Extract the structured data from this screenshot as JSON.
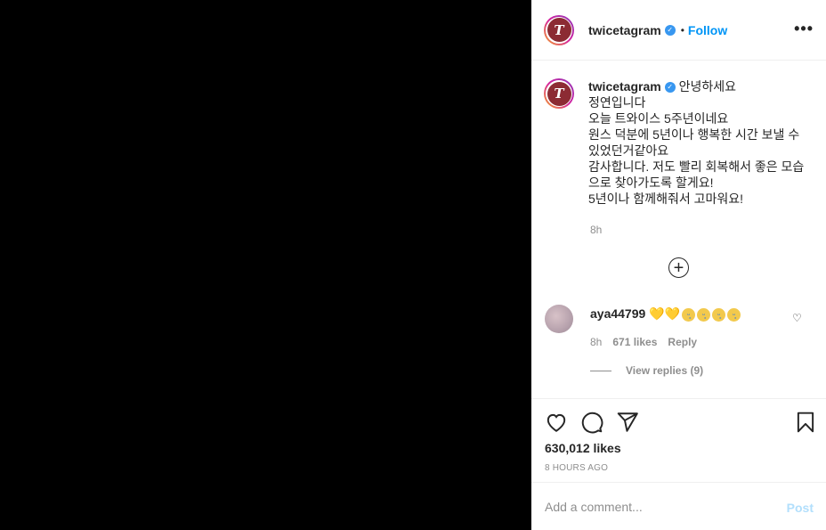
{
  "header": {
    "username": "twicetagram",
    "separator": "•",
    "follow_label": "Follow",
    "more_label": "•••",
    "avatar_initial": "T"
  },
  "caption": {
    "username": "twicetagram",
    "text": "안녕하세요\n정연입니다\n오늘 트와이스 5주년이네요\n원스 덕분에 5년이나 행복한 시간 보낼 수 있었던거같아요\n감사합니다. 저도 빨리 회복해서 좋은 모습으로 찾아가도록 할게요!\n5년이나 함께해줘서 고마워요!",
    "time": "8h"
  },
  "load_more_label": "+",
  "comment": {
    "username": "aya44799",
    "hearts": "💛💛",
    "cry_emoji_count": 4,
    "time": "8h",
    "likes": "671 likes",
    "reply_label": "Reply",
    "view_replies_label": "View replies (9)"
  },
  "post": {
    "likes": "630,012 likes",
    "posted_ago": "8 HOURS AGO"
  },
  "add_comment": {
    "placeholder": "Add a comment...",
    "post_label": "Post"
  },
  "colors": {
    "accent": "#0095f6",
    "post_disabled": "#b2dffc",
    "muted": "#8e8e8e",
    "avatar_bg": "#8c2b33"
  },
  "icons": {
    "like": "heart-outline-icon",
    "comment": "speech-bubble-icon",
    "share": "paper-plane-icon",
    "save": "bookmark-icon"
  }
}
